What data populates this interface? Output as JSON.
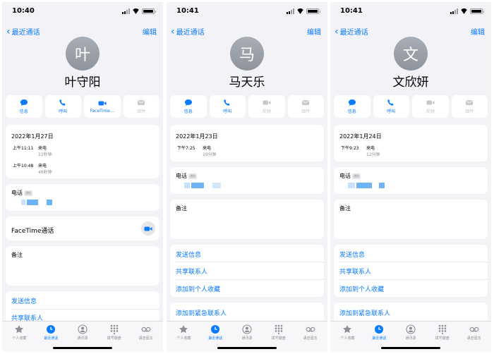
{
  "screens": [
    {
      "time": "10:40",
      "back_label": "最近通话",
      "edit_label": "编辑",
      "avatar_char": "叶",
      "name": "叶守阳",
      "actions": [
        "信息",
        "呼叫",
        "FaceTime…",
        "邮件"
      ],
      "call_date": "2022年1月27日",
      "calls": [
        {
          "time": "上午11:11",
          "type": "来电",
          "duration": "12秒钟"
        },
        {
          "time": "上午10:48",
          "type": "来电",
          "duration": "46秒钟"
        }
      ],
      "phone_label": "电话",
      "phone_badge": "通信",
      "facetime_label": "FaceTime通话",
      "notes_label": "备注",
      "links": [
        "发送信息",
        "共享联系人"
      ]
    },
    {
      "time": "10:41",
      "back_label": "最近通话",
      "edit_label": "编辑",
      "avatar_char": "马",
      "name": "马天乐",
      "actions": [
        "信息",
        "呼叫",
        "视频",
        "邮件"
      ],
      "call_date": "2022年1月23日",
      "calls": [
        {
          "time": "下午7:25",
          "type": "来电",
          "duration": "19分钟"
        }
      ],
      "phone_label": "电话",
      "phone_badge": "通信",
      "notes_label": "备注",
      "links": [
        "发送信息",
        "共享联系人",
        "添加到个人收藏",
        "添加到紧急联系人"
      ]
    },
    {
      "time": "10:41",
      "back_label": "最近通话",
      "edit_label": "编辑",
      "avatar_char": "文",
      "name": "文欣妍",
      "actions": [
        "信息",
        "呼叫",
        "视频",
        "邮件"
      ],
      "call_date": "2022年1月24日",
      "calls": [
        {
          "time": "下午9:23",
          "type": "来电",
          "duration": "12分钟"
        }
      ],
      "phone_label": "电话",
      "phone_badge": "通信",
      "notes_label": "备注",
      "links": [
        "发送信息",
        "共享联系人",
        "添加到个人收藏",
        "添加到紧急联系人"
      ]
    }
  ],
  "tabs": [
    "个人收藏",
    "最近通话",
    "通讯录",
    "拨号键盘",
    "语音留言"
  ],
  "active_tab": "最近通话",
  "colors": {
    "accent": "#0a7aff",
    "background": "#f2f2f7",
    "disabled": "#c7c7cc"
  },
  "icons": {
    "actions": [
      "message-icon",
      "phone-icon",
      "video-icon",
      "mail-icon"
    ],
    "tabs": [
      "star-icon",
      "clock-icon",
      "person-icon",
      "keypad-icon",
      "voicemail-icon"
    ]
  }
}
